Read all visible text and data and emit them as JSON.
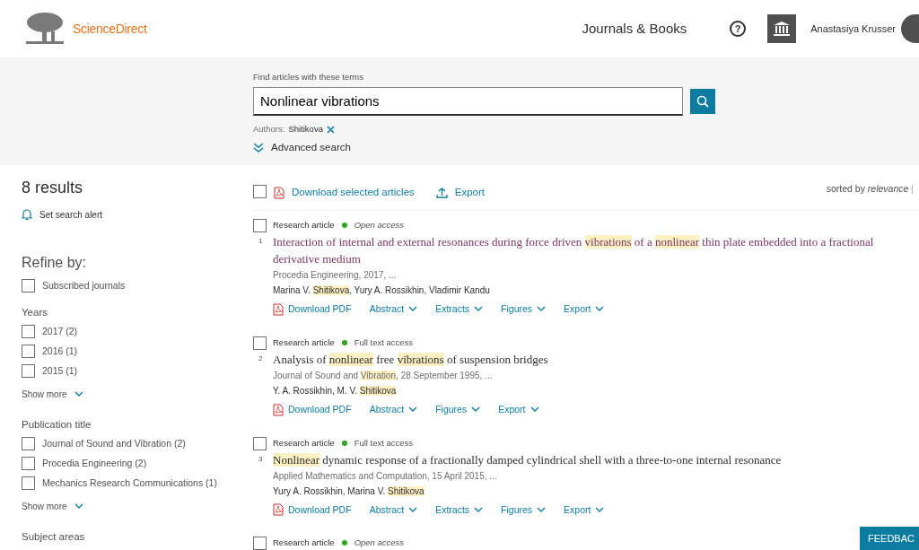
{
  "header": {
    "brand": "ScienceDirect",
    "nav_link": "Journals & Books",
    "help": "?",
    "user_name": "Anastasiya Krusser"
  },
  "search": {
    "label": "Find articles with these terms",
    "value": "Nonlinear vibrations",
    "filter_label": "Authors:",
    "filter_value": "Shitikova",
    "advanced": "Advanced search"
  },
  "sidebar": {
    "results_count": "8 results",
    "alert": "Set search alert",
    "refine_title": "Refine by:",
    "subscribed": {
      "label": "Subscribed journals",
      "checked": false
    },
    "groups": [
      {
        "title": "Years",
        "options": [
          {
            "label": "2017 (2)",
            "checked": false
          },
          {
            "label": "2016 (1)",
            "checked": false
          },
          {
            "label": "2015 (1)",
            "checked": false
          }
        ],
        "more": "Show more"
      },
      {
        "title": "Publication title",
        "options": [
          {
            "label": "Journal of Sound and Vibration (2)",
            "checked": false
          },
          {
            "label": "Procedia Engineering (2)",
            "checked": false
          },
          {
            "label": "Mechanics Research Communications (1)",
            "checked": false
          }
        ],
        "more": "Show more"
      },
      {
        "title": "Subject areas"
      }
    ]
  },
  "toolbar": {
    "select_all_checked": false,
    "download": "Download selected articles",
    "export": "Export",
    "sort_label": "sorted by",
    "sort_value": "relevance",
    "sort_sep": "|"
  },
  "results": [
    {
      "checked": false,
      "number": "1",
      "type": "Research article",
      "access": "Open access",
      "access_italic": true,
      "visited": true,
      "title": [
        {
          "text": "Interaction of internal and external resonances during force driven ",
          "highlight": false
        },
        {
          "text": "vibrations",
          "highlight": true
        },
        {
          "text": " of a ",
          "highlight": false
        },
        {
          "text": "nonlinear",
          "highlight": true
        },
        {
          "text": " thin plate embedded into a fractional derivative medium",
          "highlight": false
        }
      ],
      "source": [
        {
          "text": "Procedia Engineering, 2017, ...",
          "highlight": false
        }
      ],
      "authors": [
        {
          "text": "Marina V. ",
          "highlight": false
        },
        {
          "text": "Shitikova",
          "highlight": true
        },
        {
          "text": ", Yury A. Rossikhin, Vladimir Kandu",
          "highlight": false
        }
      ],
      "actions": [
        {
          "label": "Download PDF",
          "kind": "pdf"
        },
        {
          "label": "Abstract",
          "kind": "menu"
        },
        {
          "label": "Extracts",
          "kind": "menu"
        },
        {
          "label": "Figures",
          "kind": "menu"
        },
        {
          "label": "Export",
          "kind": "menu"
        }
      ]
    },
    {
      "checked": false,
      "number": "2",
      "type": "Research article",
      "access": "Full text access",
      "access_italic": false,
      "visited": false,
      "title": [
        {
          "text": "Analysis of ",
          "highlight": false
        },
        {
          "text": "nonlinear",
          "highlight": true
        },
        {
          "text": " free ",
          "highlight": false
        },
        {
          "text": "vibrations",
          "highlight": true
        },
        {
          "text": " of suspension bridges",
          "highlight": false
        }
      ],
      "source": [
        {
          "text": "Journal of Sound and ",
          "highlight": false
        },
        {
          "text": "Vibration",
          "highlight": true
        },
        {
          "text": ", 28 September 1995, ...",
          "highlight": false
        }
      ],
      "authors": [
        {
          "text": "Y. A. Rossikhin, M. V. ",
          "highlight": false
        },
        {
          "text": "Shitikova",
          "highlight": true
        }
      ],
      "actions": [
        {
          "label": "Download PDF",
          "kind": "pdf"
        },
        {
          "label": "Abstract",
          "kind": "menu"
        },
        {
          "label": "Figures",
          "kind": "menu"
        },
        {
          "label": "Export",
          "kind": "menu"
        }
      ]
    },
    {
      "checked": false,
      "number": "3",
      "type": "Research article",
      "access": "Full text access",
      "access_italic": false,
      "visited": false,
      "title": [
        {
          "text": "Nonlinear",
          "highlight": true
        },
        {
          "text": " dynamic response of a fractionally damped cylindrical shell with a three-to-one internal resonance",
          "highlight": false
        }
      ],
      "source": [
        {
          "text": "Applied Mathematics and Computation, 15 April 2015, ...",
          "highlight": false
        }
      ],
      "authors": [
        {
          "text": "Yury A. Rossikhin, Marina V. ",
          "highlight": false
        },
        {
          "text": "Shitikova",
          "highlight": true
        }
      ],
      "actions": [
        {
          "label": "Download PDF",
          "kind": "pdf"
        },
        {
          "label": "Abstract",
          "kind": "menu"
        },
        {
          "label": "Extracts",
          "kind": "menu"
        },
        {
          "label": "Figures",
          "kind": "menu"
        },
        {
          "label": "Export",
          "kind": "menu"
        }
      ]
    },
    {
      "checked": false,
      "type": "Research article",
      "access": "Open access",
      "access_italic": true
    }
  ],
  "feedback": "FEEDBAC"
}
